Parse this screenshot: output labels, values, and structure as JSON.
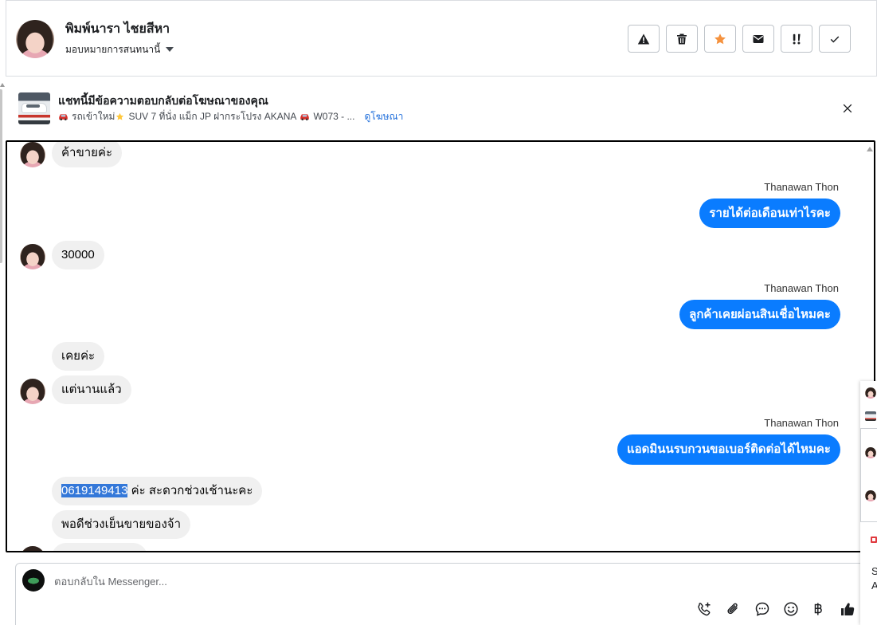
{
  "colors": {
    "outgoing_bubble": "#0a7cff",
    "incoming_bubble": "#f0f0f0",
    "link": "#216fdb",
    "star": "#f5923e",
    "selection_highlight": "#3478d9"
  },
  "header": {
    "contact_name": "พิมพ์นารา ไชยสีหา",
    "assign_label": "มอบหมายการสนทนานี้",
    "actions": [
      "warning-icon",
      "trash-icon",
      "star-icon",
      "envelope-icon",
      "follow-up-icon",
      "check-icon"
    ]
  },
  "ad_banner": {
    "title": "แชทนี้มีข้อความตอบกลับต่อโฆษณาของคุณ",
    "ad_text_segments": [
      "รถเข้าใหม่",
      "SUV 7 ที่นั่ง แม็ก JP ฝากระโปรง AKANA",
      "W073 - ..."
    ],
    "ad_text_emoji": [
      "car-emoji",
      "star-emoji",
      "car-emoji"
    ],
    "view_ad_link": "ดูโฆษณา"
  },
  "messages": [
    {
      "from_contact": true,
      "show_avatar": true,
      "text": "ค้าขายค่ะ"
    },
    {
      "from_contact": false,
      "sender": "Thanawan Thon",
      "text": "รายได้ต่อเดือนเท่าไรคะ"
    },
    {
      "from_contact": true,
      "show_avatar": true,
      "text": "30000"
    },
    {
      "from_contact": false,
      "sender": "Thanawan Thon",
      "text": "ลูกค้าเคยผ่อนสินเชื่อไหมคะ"
    },
    {
      "from_contact": true,
      "show_avatar": false,
      "text": "เคยค่ะ"
    },
    {
      "from_contact": true,
      "show_avatar": true,
      "text": "แต่นานแล้ว"
    },
    {
      "from_contact": false,
      "sender": "Thanawan Thon",
      "text": "แอดมินนรบกวนขอเบอร์ติดต่อได้ไหมคะ"
    },
    {
      "from_contact": true,
      "show_avatar": false,
      "selected_text": "0619149413",
      "text": " ค่ะ สะดวกช่วงเช้านะคะ"
    },
    {
      "from_contact": true,
      "show_avatar": false,
      "text": "พอดีช่วงเย็นขายของจ้า"
    },
    {
      "from_contact": true,
      "show_avatar": true
    }
  ],
  "composer": {
    "placeholder": "ตอบกลับใน Messenger...",
    "tools": [
      "phone-add-icon",
      "paperclip-icon",
      "chat-bubble-icon",
      "emoji-icon",
      "baht-icon",
      "thumbs-up-icon"
    ]
  },
  "side_panel": {
    "line_1": "S",
    "line_2": "A"
  }
}
